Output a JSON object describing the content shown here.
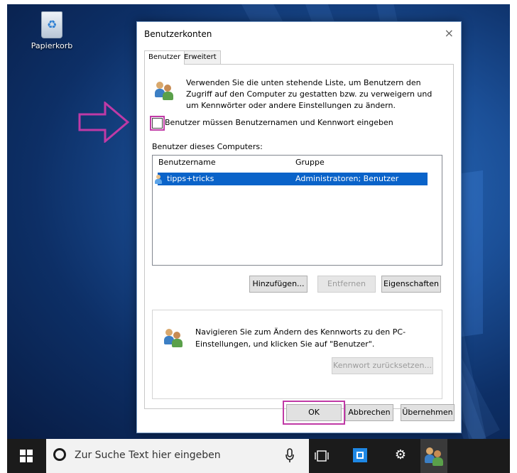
{
  "desktop": {
    "recycle_bin_label": "Papierkorb"
  },
  "dialog": {
    "title": "Benutzerkonten",
    "close_glyph": "×",
    "tabs": [
      {
        "label": "Benutzer",
        "active": true
      },
      {
        "label": "Erweitert",
        "active": false
      }
    ],
    "intro_text": "Verwenden Sie die unten stehende Liste, um Benutzern den Zugriff auf den Computer zu gestatten bzw. zu verweigern und um Kennwörter oder andere Einstellungen zu ändern.",
    "require_login_checkbox": {
      "label": "Benutzer müssen Benutzernamen und Kennwort eingeben",
      "checked": false
    },
    "users_section_label": "Benutzer dieses Computers:",
    "user_list": {
      "columns": [
        "Benutzername",
        "Gruppe"
      ],
      "rows": [
        {
          "name": "tipps+tricks",
          "group": "Administratoren; Benutzer",
          "selected": true
        }
      ]
    },
    "list_buttons": {
      "add": "Hinzufügen...",
      "remove": "Entfernen",
      "properties": "Eigenschaften"
    },
    "password_hint": "Navigieren Sie zum Ändern des Kennworts zu den PC-Einstellungen, und klicken Sie auf \"Benutzer\".",
    "reset_password_button": "Kennwort zurücksetzen...",
    "footer_buttons": {
      "ok": "OK",
      "cancel": "Abbrechen",
      "apply": "Übernehmen"
    }
  },
  "taskbar": {
    "search_placeholder": "Zur Suche Text hier eingeben",
    "icons": [
      "windows-start-icon",
      "cortana-icon",
      "microphone-icon",
      "task-view-icon",
      "store-icon",
      "settings-gear-icon",
      "user-accounts-icon"
    ]
  },
  "colors": {
    "highlight_magenta": "#c03aa6",
    "selection_blue": "#0a63c9",
    "desktop_blue": "#1b4f97"
  }
}
